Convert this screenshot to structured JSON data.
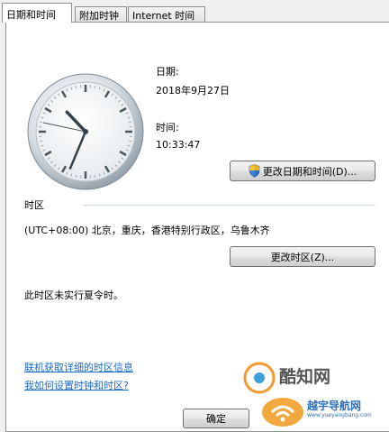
{
  "tabs": [
    "日期和时间",
    "附加时钟",
    "Internet 时间"
  ],
  "date": {
    "label": "日期:",
    "value": "2018年9月27日"
  },
  "time": {
    "label": "时间:",
    "value": "10:33:47"
  },
  "change_datetime_button": "更改日期和时间(D)...",
  "timezone": {
    "heading": "时区",
    "value": "(UTC+08:00) 北京，重庆，香港特别行政区，乌鲁木齐",
    "change_button": "更改时区(Z)...",
    "dst_note": "此时区未实行夏令时。"
  },
  "links": {
    "online_info": "联机获取详细的时区信息",
    "how_to_set": "我如何设置时钟和时区?"
  },
  "ok_button": "确定",
  "watermark": {
    "brand": "酷知网",
    "site_cn": "越宇导航网",
    "site_url": "www.yueyangbang.com"
  },
  "clock": {
    "hour": 10,
    "minute": 33,
    "second": 47
  },
  "colors": {
    "link": "#1b6ac7",
    "panel_border": "#8e8f8f"
  }
}
